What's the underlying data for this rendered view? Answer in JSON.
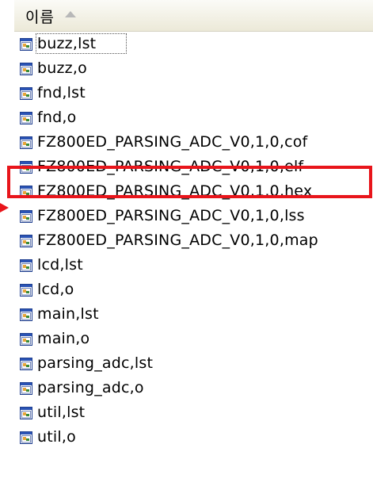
{
  "header": {
    "name_column_label": "이름",
    "sort_icon": "sort-ascending-icon"
  },
  "files": [
    {
      "name": "buzz,lst",
      "icon": "file-icon",
      "focused": true
    },
    {
      "name": "buzz,o",
      "icon": "file-icon"
    },
    {
      "name": "fnd,lst",
      "icon": "file-icon"
    },
    {
      "name": "fnd,o",
      "icon": "file-icon"
    },
    {
      "name": "FZ800ED_PARSING_ADC_V0,1,0,cof",
      "icon": "file-icon"
    },
    {
      "name": "FZ800ED_PARSING_ADC_V0,1,0,elf",
      "icon": "file-icon"
    },
    {
      "name": "FZ800ED_PARSING_ADC_V0,1,0,hex",
      "icon": "file-icon",
      "highlighted": true
    },
    {
      "name": "FZ800ED_PARSING_ADC_V0,1,0,lss",
      "icon": "file-icon"
    },
    {
      "name": "FZ800ED_PARSING_ADC_V0,1,0,map",
      "icon": "file-icon"
    },
    {
      "name": "lcd,lst",
      "icon": "file-icon"
    },
    {
      "name": "lcd,o",
      "icon": "file-icon"
    },
    {
      "name": "main,lst",
      "icon": "file-icon"
    },
    {
      "name": "main,o",
      "icon": "file-icon"
    },
    {
      "name": "parsing_adc,lst",
      "icon": "file-icon"
    },
    {
      "name": "parsing_adc,o",
      "icon": "file-icon"
    },
    {
      "name": "util,lst",
      "icon": "file-icon"
    },
    {
      "name": "util,o",
      "icon": "file-icon"
    }
  ],
  "annotation": {
    "color": "#e8151b"
  }
}
